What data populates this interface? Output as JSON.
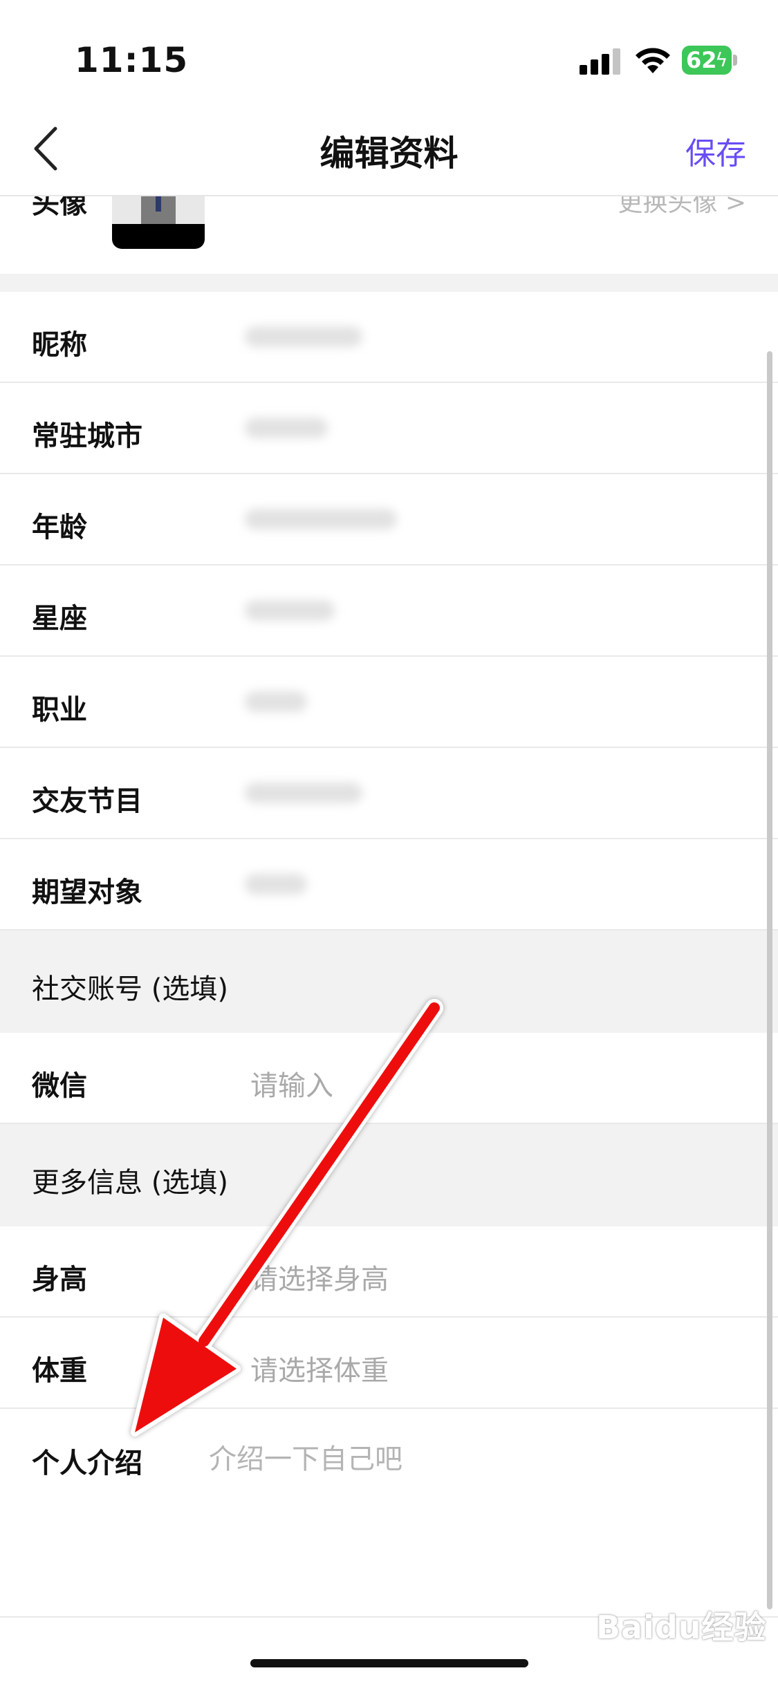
{
  "status_bar": {
    "time": "11:15",
    "battery_level": "62"
  },
  "header": {
    "back_icon": "chevron-left-icon",
    "title": "编辑资料",
    "save_label": "保存"
  },
  "avatar": {
    "label": "头像",
    "change_label": "更换头像 >"
  },
  "profile_fields": [
    {
      "label": "昵称"
    },
    {
      "label": "常驻城市"
    },
    {
      "label": "年龄"
    },
    {
      "label": "星座"
    },
    {
      "label": "职业"
    },
    {
      "label": "交友节目"
    },
    {
      "label": "期望对象"
    }
  ],
  "social_section": {
    "title": "社交账号 (选填)",
    "wechat_label": "微信",
    "wechat_placeholder": "请输入"
  },
  "more_section": {
    "title": "更多信息 (选填)",
    "height_label": "身高",
    "height_placeholder": "请选择身高",
    "weight_label": "体重",
    "weight_placeholder": "请选择体重",
    "intro_label": "个人介绍",
    "intro_placeholder": "介绍一下自己吧"
  },
  "watermark": {
    "text": "Baidu经验"
  },
  "colors": {
    "accent": "#6a4cf5",
    "battery": "#3cc758",
    "arrow": "#ee1111"
  }
}
